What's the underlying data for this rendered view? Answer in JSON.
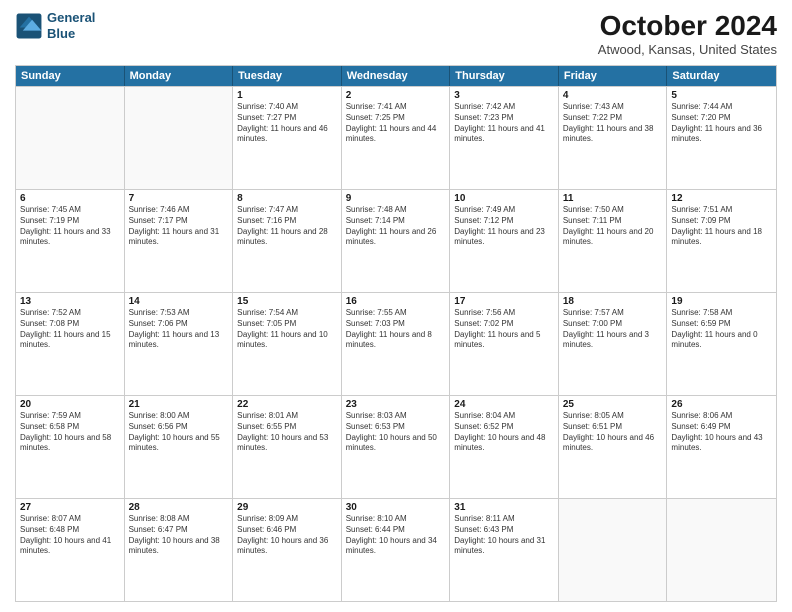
{
  "header": {
    "logo_line1": "General",
    "logo_line2": "Blue",
    "title": "October 2024",
    "location": "Atwood, Kansas, United States"
  },
  "weekdays": [
    "Sunday",
    "Monday",
    "Tuesday",
    "Wednesday",
    "Thursday",
    "Friday",
    "Saturday"
  ],
  "rows": [
    [
      {
        "day": "",
        "detail": "",
        "empty": true
      },
      {
        "day": "",
        "detail": "",
        "empty": true
      },
      {
        "day": "1",
        "detail": "Sunrise: 7:40 AM\nSunset: 7:27 PM\nDaylight: 11 hours and 46 minutes."
      },
      {
        "day": "2",
        "detail": "Sunrise: 7:41 AM\nSunset: 7:25 PM\nDaylight: 11 hours and 44 minutes."
      },
      {
        "day": "3",
        "detail": "Sunrise: 7:42 AM\nSunset: 7:23 PM\nDaylight: 11 hours and 41 minutes."
      },
      {
        "day": "4",
        "detail": "Sunrise: 7:43 AM\nSunset: 7:22 PM\nDaylight: 11 hours and 38 minutes."
      },
      {
        "day": "5",
        "detail": "Sunrise: 7:44 AM\nSunset: 7:20 PM\nDaylight: 11 hours and 36 minutes."
      }
    ],
    [
      {
        "day": "6",
        "detail": "Sunrise: 7:45 AM\nSunset: 7:19 PM\nDaylight: 11 hours and 33 minutes."
      },
      {
        "day": "7",
        "detail": "Sunrise: 7:46 AM\nSunset: 7:17 PM\nDaylight: 11 hours and 31 minutes."
      },
      {
        "day": "8",
        "detail": "Sunrise: 7:47 AM\nSunset: 7:16 PM\nDaylight: 11 hours and 28 minutes."
      },
      {
        "day": "9",
        "detail": "Sunrise: 7:48 AM\nSunset: 7:14 PM\nDaylight: 11 hours and 26 minutes."
      },
      {
        "day": "10",
        "detail": "Sunrise: 7:49 AM\nSunset: 7:12 PM\nDaylight: 11 hours and 23 minutes."
      },
      {
        "day": "11",
        "detail": "Sunrise: 7:50 AM\nSunset: 7:11 PM\nDaylight: 11 hours and 20 minutes."
      },
      {
        "day": "12",
        "detail": "Sunrise: 7:51 AM\nSunset: 7:09 PM\nDaylight: 11 hours and 18 minutes."
      }
    ],
    [
      {
        "day": "13",
        "detail": "Sunrise: 7:52 AM\nSunset: 7:08 PM\nDaylight: 11 hours and 15 minutes."
      },
      {
        "day": "14",
        "detail": "Sunrise: 7:53 AM\nSunset: 7:06 PM\nDaylight: 11 hours and 13 minutes."
      },
      {
        "day": "15",
        "detail": "Sunrise: 7:54 AM\nSunset: 7:05 PM\nDaylight: 11 hours and 10 minutes."
      },
      {
        "day": "16",
        "detail": "Sunrise: 7:55 AM\nSunset: 7:03 PM\nDaylight: 11 hours and 8 minutes."
      },
      {
        "day": "17",
        "detail": "Sunrise: 7:56 AM\nSunset: 7:02 PM\nDaylight: 11 hours and 5 minutes."
      },
      {
        "day": "18",
        "detail": "Sunrise: 7:57 AM\nSunset: 7:00 PM\nDaylight: 11 hours and 3 minutes."
      },
      {
        "day": "19",
        "detail": "Sunrise: 7:58 AM\nSunset: 6:59 PM\nDaylight: 11 hours and 0 minutes."
      }
    ],
    [
      {
        "day": "20",
        "detail": "Sunrise: 7:59 AM\nSunset: 6:58 PM\nDaylight: 10 hours and 58 minutes."
      },
      {
        "day": "21",
        "detail": "Sunrise: 8:00 AM\nSunset: 6:56 PM\nDaylight: 10 hours and 55 minutes."
      },
      {
        "day": "22",
        "detail": "Sunrise: 8:01 AM\nSunset: 6:55 PM\nDaylight: 10 hours and 53 minutes."
      },
      {
        "day": "23",
        "detail": "Sunrise: 8:03 AM\nSunset: 6:53 PM\nDaylight: 10 hours and 50 minutes."
      },
      {
        "day": "24",
        "detail": "Sunrise: 8:04 AM\nSunset: 6:52 PM\nDaylight: 10 hours and 48 minutes."
      },
      {
        "day": "25",
        "detail": "Sunrise: 8:05 AM\nSunset: 6:51 PM\nDaylight: 10 hours and 46 minutes."
      },
      {
        "day": "26",
        "detail": "Sunrise: 8:06 AM\nSunset: 6:49 PM\nDaylight: 10 hours and 43 minutes."
      }
    ],
    [
      {
        "day": "27",
        "detail": "Sunrise: 8:07 AM\nSunset: 6:48 PM\nDaylight: 10 hours and 41 minutes."
      },
      {
        "day": "28",
        "detail": "Sunrise: 8:08 AM\nSunset: 6:47 PM\nDaylight: 10 hours and 38 minutes."
      },
      {
        "day": "29",
        "detail": "Sunrise: 8:09 AM\nSunset: 6:46 PM\nDaylight: 10 hours and 36 minutes."
      },
      {
        "day": "30",
        "detail": "Sunrise: 8:10 AM\nSunset: 6:44 PM\nDaylight: 10 hours and 34 minutes."
      },
      {
        "day": "31",
        "detail": "Sunrise: 8:11 AM\nSunset: 6:43 PM\nDaylight: 10 hours and 31 minutes."
      },
      {
        "day": "",
        "detail": "",
        "empty": true
      },
      {
        "day": "",
        "detail": "",
        "empty": true
      }
    ]
  ]
}
